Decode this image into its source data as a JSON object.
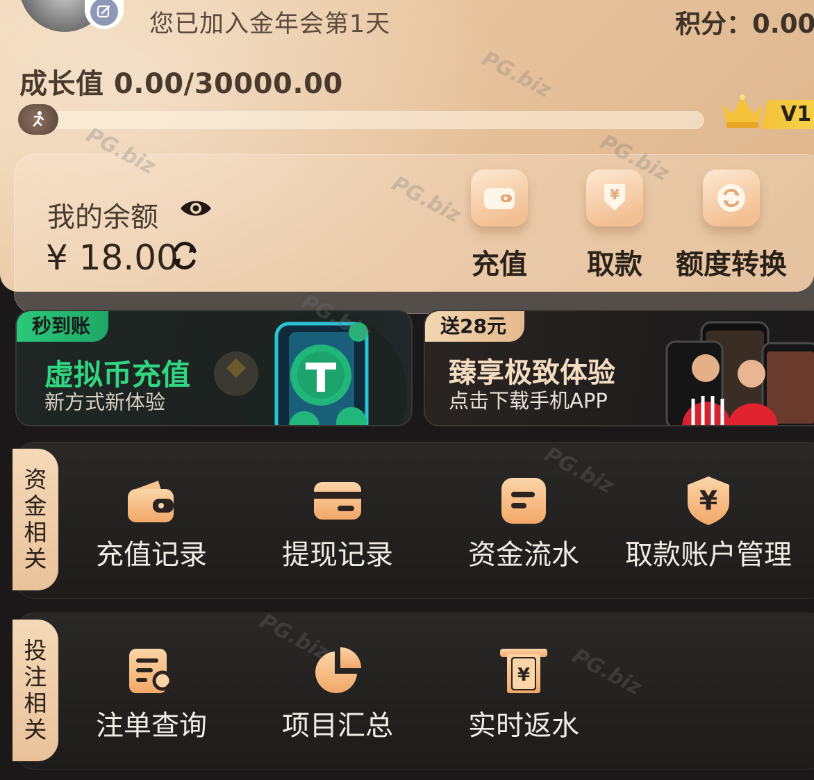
{
  "header": {
    "join_text": "您已加入金年会第1天",
    "points_label": "积分：0.00",
    "growth_label": "成长值 0.00/30000.00",
    "progress": 0.0,
    "level": "V1"
  },
  "balance": {
    "label": "我的余额",
    "value": "¥ 18.00"
  },
  "actions": [
    {
      "label": "充值",
      "icon": "wallet-icon"
    },
    {
      "label": "取款",
      "icon": "withdraw-icon"
    },
    {
      "label": "额度转换",
      "icon": "transfer-icon"
    }
  ],
  "banners": [
    {
      "ribbon": "秒到账",
      "title": "虚拟币充值",
      "subtitle": "新方式新体验"
    },
    {
      "ribbon": "送28元",
      "title": "臻享极致体验",
      "subtitle": "点击下载手机APP"
    }
  ],
  "sections": [
    {
      "tab": "资金相关",
      "items": [
        {
          "label": "充值记录",
          "icon": "wallet-icon"
        },
        {
          "label": "提现记录",
          "icon": "card-icon"
        },
        {
          "label": "资金流水",
          "icon": "ledger-icon"
        },
        {
          "label": "取款账户管理",
          "icon": "shield-yen-icon"
        }
      ]
    },
    {
      "tab": "投注相关",
      "items": [
        {
          "label": "注单查询",
          "icon": "search-document-icon"
        },
        {
          "label": "项目汇总",
          "icon": "pie-chart-icon"
        },
        {
          "label": "实时返水",
          "icon": "rebate-icon"
        }
      ]
    }
  ],
  "colors": {
    "accent_gold": "#f3c094",
    "panel_bg": "#e7c39d",
    "dark_bg": "#1a1818",
    "green": "#30d681"
  }
}
